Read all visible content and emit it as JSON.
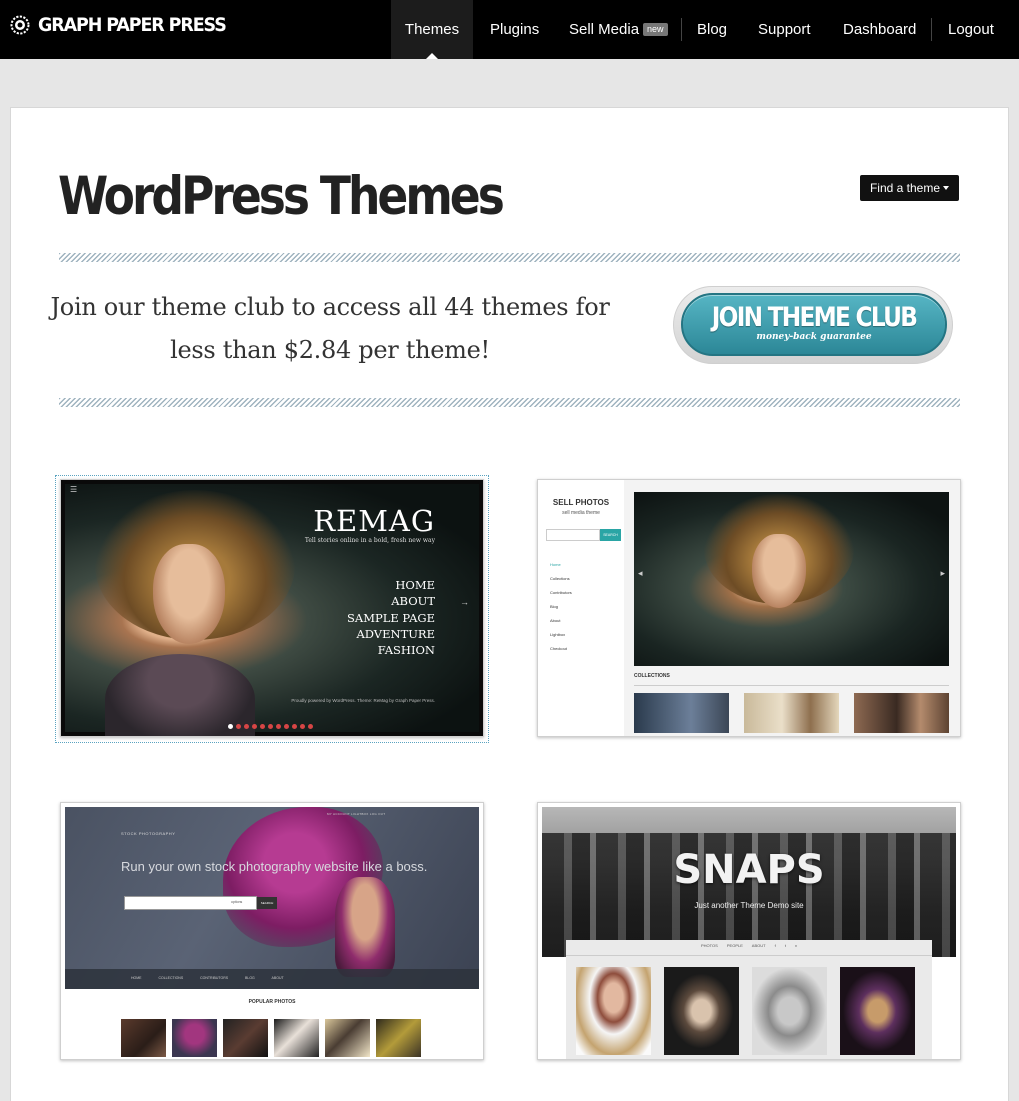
{
  "header": {
    "brand": "GRAPH PAPER PRESS",
    "nav": [
      {
        "label": "Themes",
        "active": true
      },
      {
        "label": "Plugins"
      },
      {
        "label": "Sell Media",
        "badge": "new"
      },
      {
        "label": "Blog"
      },
      {
        "label": "Support"
      },
      {
        "label": "Dashboard"
      },
      {
        "label": "Logout"
      }
    ]
  },
  "main": {
    "title": "WordPress Themes",
    "find_theme": "Find a theme",
    "promo_line1": "Join our theme club to access all 44 themes for",
    "promo_line2": "less than $2.84 per theme!",
    "join_label": "JOIN THEME CLUB",
    "join_sub": "money-back guarantee"
  },
  "themes": {
    "remag": {
      "title": "REMAG",
      "tagline": "Tell stories online in a bold, fresh new way",
      "menu": [
        "HOME",
        "ABOUT",
        "SAMPLE PAGE",
        "ADVENTURE",
        "FASHION"
      ],
      "footer": "Proudly powered by WordPress. Theme: ReMag by Graph Paper Press."
    },
    "sell": {
      "title": "SELL PHOTOS",
      "subtitle": "sell media theme",
      "search_btn": "SEARCH",
      "links": [
        "Home",
        "Collections",
        "Contributors",
        "Blog",
        "About",
        "Lightbox",
        "Checkout"
      ],
      "collections": "COLLECTIONS"
    },
    "stock": {
      "brand": "STOCK PHOTOGRAPHY",
      "toplinks": "MY ACCOUNT   LIGHTBOX   LOG OUT",
      "headline": "Run your own stock photography website like a boss.",
      "options": "options",
      "search_btn": "SEARCH",
      "nav": "HOME COLLECTIONS CONTRIBUTORS BLOG ABOUT",
      "popular": "POPULAR PHOTOS"
    },
    "snaps": {
      "title": "SNAPS",
      "tagline": "Just another Theme Demo site",
      "nav": "PHOTOS PEOPLE ABOUT f t v"
    }
  },
  "colors": {
    "topbar": "#000000",
    "accent_teal": "#3a9fae",
    "badge": "#777777"
  }
}
